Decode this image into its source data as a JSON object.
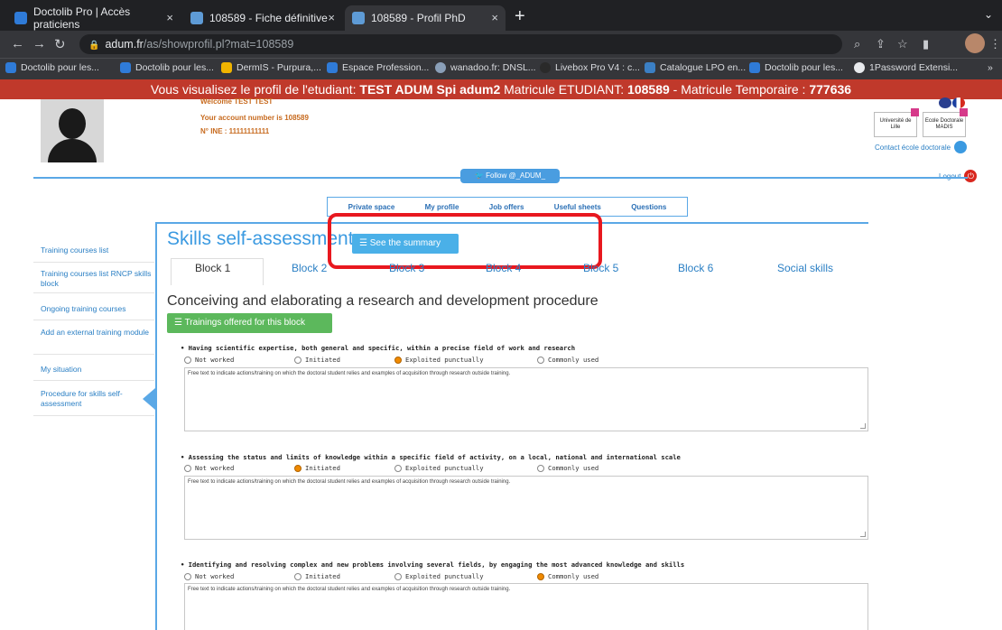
{
  "browser": {
    "tabs": [
      {
        "label": "Doctolib Pro | Accès praticiens",
        "active": false
      },
      {
        "label": "108589 - Fiche définitive",
        "active": false
      },
      {
        "label": "108589 - Profil PhD",
        "active": true
      }
    ],
    "url_host": "adum.fr",
    "url_path": "/as/showprofil.pl?mat=108589",
    "bookmarks": [
      "Doctolib pour les...",
      "Doctolib pour les...",
      "DermIS - Purpura,...",
      "Espace Profession...",
      "wanadoo.fr: DNSL...",
      "Livebox Pro V4 : c...",
      "Catalogue LPO en...",
      "Doctolib pour les...",
      "1Password Extensi..."
    ]
  },
  "banner": {
    "prefix": "Vous visualisez le profil de l'etudiant: ",
    "name": "TEST ADUM Spi adum2",
    "mid": " Matricule ETUDIANT: ",
    "matricule": "108589",
    "suffix": " - Matricule Temporaire : ",
    "temp": "777636"
  },
  "profile": {
    "welcome": "Welcome TEST TEST",
    "account": "Your account number is 108589",
    "ine": "N° INE : 11111111111"
  },
  "logos": {
    "lille": "Université de Lille",
    "ecole": "Ecole Doctorale MADIS"
  },
  "links": {
    "contact": "Contact école doctorale",
    "logout": "Logout",
    "follow": "Follow @_ADUM_"
  },
  "topnav": [
    "Private space",
    "My profile",
    "Job offers",
    "Useful sheets",
    "Questions"
  ],
  "sidebar": [
    "Training courses list",
    "Training courses list RNCP skills block",
    "Ongoing training courses",
    "Add an external training module",
    "My situation",
    "Procedure for skills self-assessment"
  ],
  "main": {
    "title": "Skills self-assessment",
    "summary_button": "See the summary",
    "blocks": [
      "Block 1",
      "Block 2",
      "Block 3",
      "Block 4",
      "Block 5",
      "Block 6",
      "Social skills"
    ],
    "section_title": "Conceiving and elaborating a research and development procedure",
    "trainings_button": "Trainings offered for this block",
    "options": [
      "Not worked",
      "Initiated",
      "Exploited punctually",
      "Commonly used"
    ],
    "placeholder": "Free text to indicate actions/training on which the doctoral student relies and examples of acquisition through research outside training.",
    "questions": [
      {
        "text": "Having scientific expertise, both general and specific, within a precise field of work and research",
        "selected": 2
      },
      {
        "text": "Assessing the status and limits of knowledge within a specific field of activity, on a local, national and international scale",
        "selected": 1
      },
      {
        "text": "Identifying and resolving complex and new problems involving several fields, by engaging the most advanced knowledge and skills",
        "selected": 3
      }
    ]
  }
}
